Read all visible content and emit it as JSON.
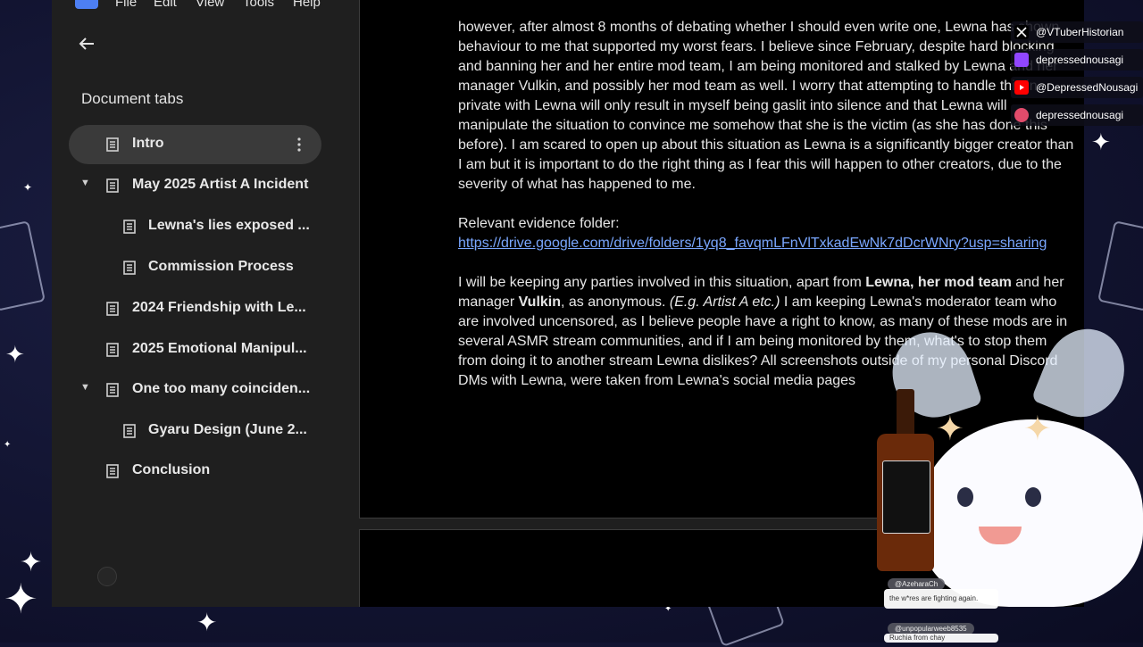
{
  "menubar": {
    "items": [
      "File",
      "Edit",
      "View",
      "Tools",
      "Help"
    ]
  },
  "sidebar": {
    "back_icon": "arrow-back-icon",
    "heading": "Document tabs",
    "tabs": [
      {
        "label": "Intro",
        "active": true,
        "expandable": false,
        "depth": 0
      },
      {
        "label": "May 2025 Artist A Incident",
        "active": false,
        "expandable": true,
        "depth": 0
      },
      {
        "label": "Lewna's lies exposed ...",
        "active": false,
        "expandable": false,
        "depth": 1
      },
      {
        "label": "Commission Process",
        "active": false,
        "expandable": false,
        "depth": 1
      },
      {
        "label": "2024 Friendship with Le...",
        "active": false,
        "expandable": false,
        "depth": 0
      },
      {
        "label": "2025 Emotional Manipul...",
        "active": false,
        "expandable": false,
        "depth": 0
      },
      {
        "label": "One too many coinciden...",
        "active": false,
        "expandable": true,
        "depth": 0
      },
      {
        "label": "Gyaru Design (June 2...",
        "active": false,
        "expandable": false,
        "depth": 1
      },
      {
        "label": "Conclusion",
        "active": false,
        "expandable": false,
        "depth": 0
      }
    ]
  },
  "document": {
    "para1": "however, after almost 8 months of debating whether I should even write one, Lewna has shown behaviour to me that supported my worst fears. I believe since February, despite hard blocking and banning her and her entire mod team, I am being monitored and stalked by Lewna and her manager Vulkin, and possibly her mod team as well. I worry that attempting to handle this in private with Lewna will only result in myself being gaslit into silence and that Lewna will manipulate the situation to convince me somehow that she is the victim (as she has done this before). I am scared to open up about this situation as Lewna is a significantly bigger creator than I am but it is important to do the right thing as I fear this will happen to other creators, due to the severity of what has happened to me.",
    "evidence_label": "Relevant evidence folder:",
    "evidence_link": "https://drive.google.com/drive/folders/1yq8_favqmLFnVlTxkadEwNk7dDcrWNry?usp=sharing",
    "para3_a": "I will be keeping any parties involved in this situation, apart from ",
    "para3_b": "Lewna, her mod team",
    "para3_c": " and her manager ",
    "para3_d": "Vulkin",
    "para3_e": ", as anonymous. ",
    "para3_f": "(E.g. Artist A etc.)",
    "para3_g": " I am keeping Lewna's moderator team who are involved uncensored, as I believe people have a right to know, as many of these mods are in several ASMR stream communities, and if I am being monitored by them, what's to stop them from doing it to another stream Lewna dislikes? All screenshots outside of my personal Discord DMs with Lewna, were taken from Lewna's social media pages"
  },
  "overlay": {
    "socials": [
      {
        "platform": "x",
        "icon": "x-logo-icon",
        "handle": "@VTuberHistorian",
        "color": "#000000"
      },
      {
        "platform": "twitch",
        "icon": "twitch-logo-icon",
        "handle": "depressednousagi",
        "color": "#9146ff"
      },
      {
        "platform": "youtube",
        "icon": "youtube-logo-icon",
        "handle": "@DepressedNousagi",
        "color": "#ff0000"
      },
      {
        "platform": "tiktok",
        "icon": "tiktok-logo-icon",
        "handle": "depressednousagi",
        "color": "#e14b6b"
      }
    ],
    "chat": [
      {
        "user": "@AzeharaCh",
        "message": "the w*res are fighting again."
      },
      {
        "user": "@unpopularweeb8535",
        "message": "Ruchia from chay"
      }
    ]
  },
  "colors": {
    "background": "#121431",
    "docs_panel": "#1f1f1f",
    "page": "#000000",
    "link": "#7aa7ff",
    "active_tab": "#3a3a3a"
  }
}
